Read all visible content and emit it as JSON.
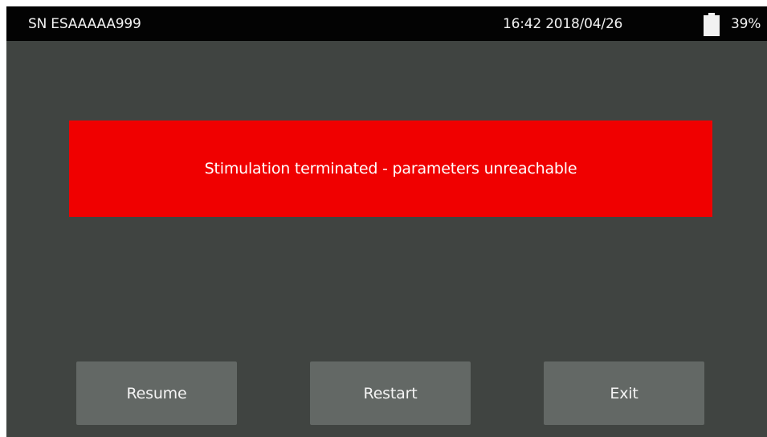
{
  "status_bar": {
    "serial": "SN ESAAAAA999",
    "datetime": "16:42 2018/04/26",
    "battery_icon": "battery-icon",
    "battery_percent": "39%"
  },
  "alert": {
    "message": "Stimulation terminated - parameters unreachable",
    "color": "#f00000"
  },
  "actions": {
    "resume_label": "Resume",
    "restart_label": "Restart",
    "exit_label": "Exit"
  }
}
